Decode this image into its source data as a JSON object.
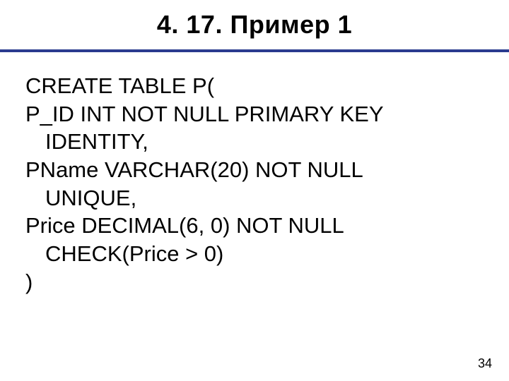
{
  "slide": {
    "title": "4. 17. Пример 1",
    "code": {
      "l1": "CREATE TABLE P(",
      "l2": "P_ID INT NOT NULL PRIMARY KEY",
      "l3": "IDENTITY,",
      "l4": "PName VARCHAR(20) NOT NULL",
      "l5": "UNIQUE,",
      "l6": "Price DECIMAL(6, 0) NOT NULL",
      "l7": "CHECK(Price > 0)",
      "l8": ")"
    },
    "page_number": "34"
  }
}
